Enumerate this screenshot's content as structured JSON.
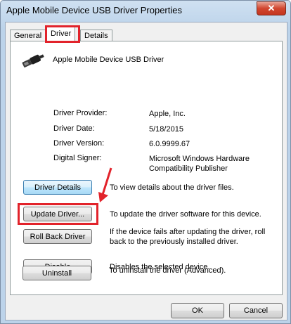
{
  "window": {
    "title": "Apple Mobile Device USB Driver Properties",
    "close_glyph": "✕"
  },
  "tabs": [
    {
      "label": "General"
    },
    {
      "label": "Driver"
    },
    {
      "label": "Details"
    }
  ],
  "device": {
    "name": "Apple Mobile Device USB Driver",
    "icon": "usb-connector-icon"
  },
  "properties": [
    {
      "label": "Driver Provider:",
      "value": "Apple, Inc."
    },
    {
      "label": "Driver Date:",
      "value": "5/18/2015"
    },
    {
      "label": "Driver Version:",
      "value": "6.0.9999.67"
    },
    {
      "label": "Digital Signer:",
      "value": "Microsoft Windows Hardware Compatibility Publisher"
    }
  ],
  "actions": [
    {
      "button": "Driver Details",
      "description": "To view details about the driver files."
    },
    {
      "button": "Update Driver...",
      "description": "To update the driver software for this device."
    },
    {
      "button": "Roll Back Driver",
      "description": "If the device fails after updating the driver, roll back to the previously installed driver."
    },
    {
      "button": "Disable",
      "description": "Disables the selected device."
    },
    {
      "button": "Uninstall",
      "description": "To uninstall the driver (Advanced)."
    }
  ],
  "footer": {
    "ok_label": "OK",
    "cancel_label": "Cancel"
  },
  "colors": {
    "highlight": "#e2232b"
  }
}
